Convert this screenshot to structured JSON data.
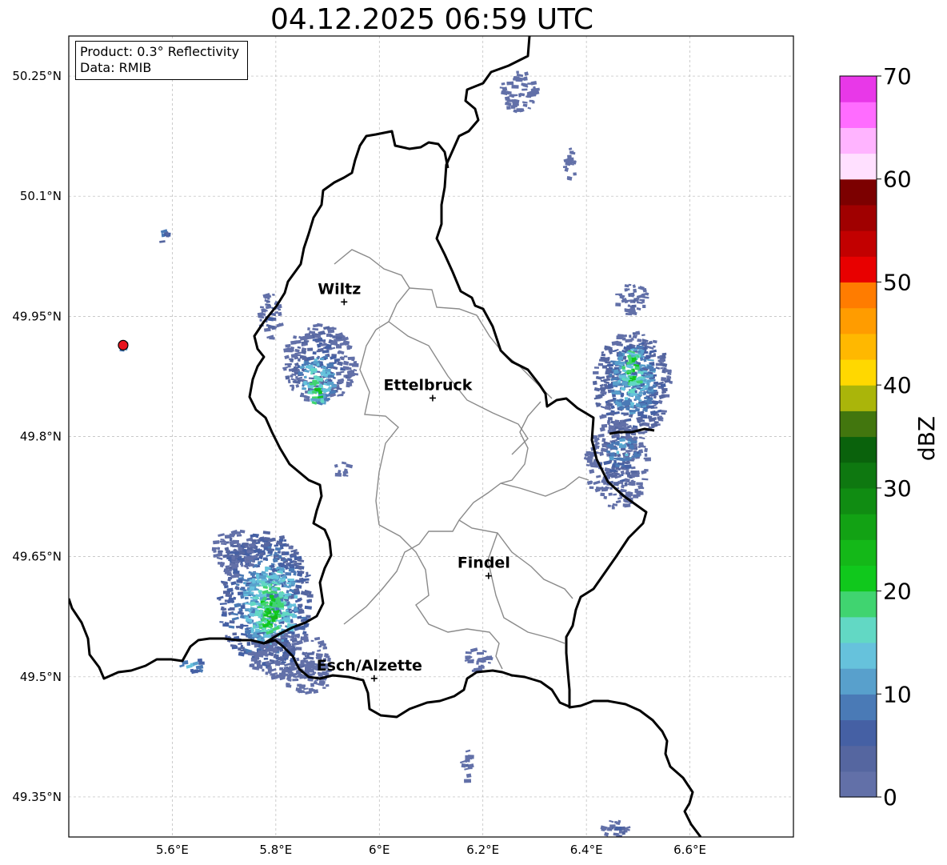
{
  "title": "04.12.2025 06:59 UTC",
  "info": {
    "product": "Product: 0.3° Reflectivity",
    "data": "Data: RMIB"
  },
  "map": {
    "lon_range": [
      5.4,
      6.8
    ],
    "lat_range": [
      49.3,
      50.3
    ],
    "lon_ticks": [
      {
        "value": 5.6,
        "label": "5.6°E"
      },
      {
        "value": 5.8,
        "label": "5.8°E"
      },
      {
        "value": 6.0,
        "label": "6°E"
      },
      {
        "value": 6.2,
        "label": "6.2°E"
      },
      {
        "value": 6.4,
        "label": "6.4°E"
      },
      {
        "value": 6.6,
        "label": "6.6°E"
      }
    ],
    "lat_ticks": [
      {
        "value": 49.35,
        "label": "49.35°N"
      },
      {
        "value": 49.5,
        "label": "49.5°N"
      },
      {
        "value": 49.65,
        "label": "49.65°N"
      },
      {
        "value": 49.8,
        "label": "49.8°N"
      },
      {
        "value": 49.95,
        "label": "49.95°N"
      },
      {
        "value": 50.1,
        "label": "50.1°N"
      },
      {
        "value": 50.25,
        "label": "50.25°N"
      }
    ],
    "cities": [
      {
        "name": "Wiltz",
        "lon": 5.932,
        "lat": 49.968
      },
      {
        "name": "Ettelbruck",
        "lon": 6.103,
        "lat": 49.848
      },
      {
        "name": "Findel",
        "lon": 6.211,
        "lat": 49.626
      },
      {
        "name": "Esch/Alzette",
        "lon": 5.99,
        "lat": 49.498
      }
    ],
    "radar_site": {
      "lon": 5.505,
      "lat": 49.914,
      "color": "#e8141e"
    },
    "echoes": [
      {
        "lon": 5.78,
        "lat": 49.595,
        "rlon": 0.09,
        "rlat": 0.085,
        "dbz": 12
      },
      {
        "lon": 5.79,
        "lat": 49.59,
        "rlon": 0.05,
        "rlat": 0.05,
        "dbz": 20
      },
      {
        "lon": 5.79,
        "lat": 49.58,
        "rlon": 0.025,
        "rlat": 0.03,
        "dbz": 24
      },
      {
        "lon": 5.72,
        "lat": 49.655,
        "rlon": 0.04,
        "rlat": 0.03,
        "dbz": 6
      },
      {
        "lon": 5.83,
        "lat": 49.525,
        "rlon": 0.08,
        "rlat": 0.03,
        "dbz": 6
      },
      {
        "lon": 5.86,
        "lat": 49.5,
        "rlon": 0.05,
        "rlat": 0.02,
        "dbz": 4
      },
      {
        "lon": 5.64,
        "lat": 49.514,
        "rlon": 0.025,
        "rlat": 0.008,
        "dbz": 15
      },
      {
        "lon": 5.885,
        "lat": 49.89,
        "rlon": 0.07,
        "rlat": 0.05,
        "dbz": 8
      },
      {
        "lon": 5.88,
        "lat": 49.87,
        "rlon": 0.035,
        "rlat": 0.03,
        "dbz": 18
      },
      {
        "lon": 5.88,
        "lat": 49.855,
        "rlon": 0.015,
        "rlat": 0.02,
        "dbz": 23
      },
      {
        "lon": 5.79,
        "lat": 49.95,
        "rlon": 0.02,
        "rlat": 0.03,
        "dbz": 6
      },
      {
        "lon": 6.49,
        "lat": 49.865,
        "rlon": 0.075,
        "rlat": 0.065,
        "dbz": 10
      },
      {
        "lon": 6.49,
        "lat": 49.87,
        "rlon": 0.045,
        "rlat": 0.045,
        "dbz": 16
      },
      {
        "lon": 6.49,
        "lat": 49.88,
        "rlon": 0.02,
        "rlat": 0.03,
        "dbz": 23
      },
      {
        "lon": 6.46,
        "lat": 49.765,
        "rlon": 0.06,
        "rlat": 0.055,
        "dbz": 6
      },
      {
        "lon": 6.47,
        "lat": 49.78,
        "rlon": 0.03,
        "rlat": 0.02,
        "dbz": 15
      },
      {
        "lon": 6.49,
        "lat": 49.97,
        "rlon": 0.03,
        "rlat": 0.02,
        "dbz": 4
      },
      {
        "lon": 6.27,
        "lat": 50.23,
        "rlon": 0.035,
        "rlat": 0.025,
        "dbz": 4
      },
      {
        "lon": 6.19,
        "lat": 49.52,
        "rlon": 0.025,
        "rlat": 0.015,
        "dbz": 4
      },
      {
        "lon": 6.46,
        "lat": 49.31,
        "rlon": 0.03,
        "rlat": 0.012,
        "dbz": 5
      },
      {
        "lon": 5.585,
        "lat": 50.05,
        "rlon": 0.006,
        "rlat": 0.01,
        "dbz": 12
      },
      {
        "lon": 5.505,
        "lat": 49.914,
        "rlon": 0.008,
        "rlat": 0.007,
        "dbz": 16
      },
      {
        "lon": 5.93,
        "lat": 49.76,
        "rlon": 0.015,
        "rlat": 0.01,
        "dbz": 4
      },
      {
        "lon": 6.37,
        "lat": 50.14,
        "rlon": 0.012,
        "rlat": 0.02,
        "dbz": 3
      },
      {
        "lon": 6.17,
        "lat": 49.39,
        "rlon": 0.01,
        "rlat": 0.02,
        "dbz": 3
      }
    ]
  },
  "colorbar": {
    "unit": "dBZ",
    "min": 0,
    "max": 70,
    "ticks": [
      {
        "value": 0,
        "label": "0"
      },
      {
        "value": 10,
        "label": "10"
      },
      {
        "value": 20,
        "label": "20"
      },
      {
        "value": 30,
        "label": "30"
      },
      {
        "value": 40,
        "label": "40"
      },
      {
        "value": 50,
        "label": "50"
      },
      {
        "value": 60,
        "label": "60"
      },
      {
        "value": 70,
        "label": "70"
      }
    ],
    "colors": [
      "#6270a8",
      "#5566a0",
      "#4560a4",
      "#4a7ab6",
      "#58a0cc",
      "#66c2dc",
      "#62d8c4",
      "#40d470",
      "#10c81c",
      "#14b818",
      "#12a214",
      "#108c12",
      "#0e7810",
      "#0a620c",
      "#42760e",
      "#aab50a",
      "#ffd800",
      "#ffb800",
      "#ff9c00",
      "#ff7c00",
      "#e80000",
      "#c20000",
      "#a00000",
      "#7c0000",
      "#ffe0ff",
      "#ffb4ff",
      "#ff6cff",
      "#e838e8"
    ]
  }
}
